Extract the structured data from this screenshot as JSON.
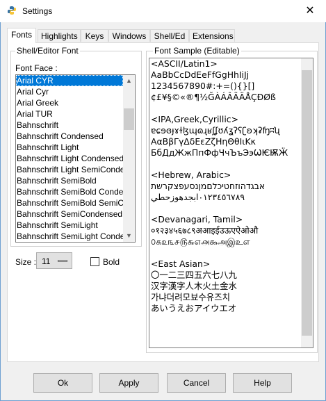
{
  "window": {
    "title": "Settings",
    "close_glyph": "✕",
    "icon": "python-icon"
  },
  "tabs": [
    {
      "label": "Fonts",
      "active": true
    },
    {
      "label": "Highlights",
      "active": false
    },
    {
      "label": "Keys",
      "active": false
    },
    {
      "label": "Windows",
      "active": false
    },
    {
      "label": "Shell/Ed",
      "active": false
    },
    {
      "label": "Extensions",
      "active": false
    }
  ],
  "font_group": {
    "title": "Shell/Editor Font",
    "face_label": "Font Face :",
    "fonts": [
      {
        "name": "Arial CYR",
        "selected": true
      },
      {
        "name": "Arial Cyr",
        "selected": false
      },
      {
        "name": "Arial Greek",
        "selected": false
      },
      {
        "name": "Arial TUR",
        "selected": false
      },
      {
        "name": "Bahnschrift",
        "selected": false
      },
      {
        "name": "Bahnschrift Condensed",
        "selected": false
      },
      {
        "name": "Bahnschrift Light",
        "selected": false
      },
      {
        "name": "Bahnschrift Light Condensed",
        "selected": false
      },
      {
        "name": "Bahnschrift Light SemiCondensed",
        "selected": false
      },
      {
        "name": "Bahnschrift SemiBold",
        "selected": false
      },
      {
        "name": "Bahnschrift SemiBold Condensed",
        "selected": false
      },
      {
        "name": "Bahnschrift SemiBold SemiCondensed",
        "selected": false
      },
      {
        "name": "Bahnschrift SemiCondensed",
        "selected": false
      },
      {
        "name": "Bahnschrift SemiLight",
        "selected": false
      },
      {
        "name": "Bahnschrift SemiLight Condensed",
        "selected": false
      }
    ],
    "size_label": "Size :",
    "size_value": "11",
    "bold_label": "Bold",
    "bold_checked": false
  },
  "sample": {
    "title": "Font Sample (Editable)",
    "lines": [
      "<ASCII/Latin1>",
      "AaBbCcDdEeFfGgHhIiJj",
      "1234567890#:+=(){}[]",
      "¢£¥§©«®¶½ĞÀÁÂÃÄÅÇÐØß",
      "",
      "<IPA,Greek,Cyrillic>",
      "ɐɕɘɞɟɤɫɮɰɷɻʁʃʆʊʎʓʔʕʗʚʞʡʩʭʯ",
      "ΑαΒβΓγΔδΕεΖζΗηΘθΙιΚκ",
      "БбДдЖжПпФфЧчЪъЭэѠѤѬӜ",
      "",
      "<Hebrew, Arabic>",
      "אבגדהוזחטיכלםמןנסעפצקרשת",
      "٠١٢٣٤٥٦٧٨٩ابجدهوزحطي",
      "",
      "<Devanagari, Tamil>",
      "०१२३४५६७८९अआइईउऊएऐओऔ",
      "௦௧௨௩௪௫௬௭௮௯அஇஉஎ",
      "",
      "<East Asian>",
      "〇一二三四五六七八九",
      "汉字漢字人木火土金水",
      "가냐더려모뵤수유즈치",
      "あいうえおアイウエオ"
    ]
  },
  "buttons": {
    "ok": "Ok",
    "apply": "Apply",
    "cancel": "Cancel",
    "help": "Help"
  },
  "colors": {
    "selection": "#0078d7",
    "window_border": "#6d9fd1"
  }
}
